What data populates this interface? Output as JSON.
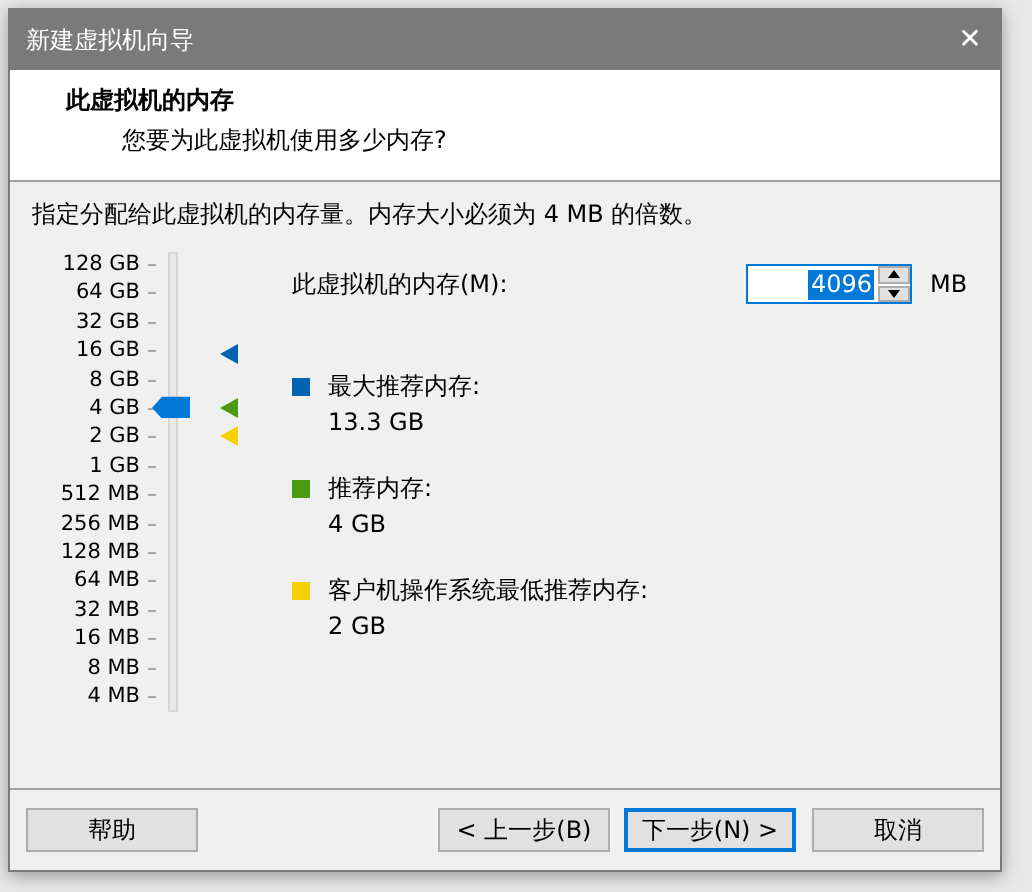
{
  "window": {
    "title": "新建虚拟机向导",
    "close": "✕"
  },
  "header": {
    "title": "此虚拟机的内存",
    "subtitle": "您要为此虚拟机使用多少内存?"
  },
  "intro": "指定分配给此虚拟机的内存量。内存大小必须为 4 MB 的倍数。",
  "slider": {
    "ticks": [
      "128 GB",
      "64 GB",
      "32 GB",
      "16 GB",
      "8 GB",
      "4 GB",
      "2 GB",
      "1 GB",
      "512 MB",
      "256 MB",
      "128 MB",
      "64 MB",
      "32 MB",
      "16 MB",
      "8 MB",
      "4 MB"
    ],
    "level": 0.667,
    "markers": [
      {
        "color": "#0063b1",
        "level": 0.792
      },
      {
        "color": "#4c9a10",
        "level": 0.667
      },
      {
        "color": "#f5d000",
        "level": 0.6
      }
    ]
  },
  "memory_field": {
    "label": "此虚拟机的内存(M):",
    "value": "4096",
    "unit": "MB"
  },
  "legend": [
    {
      "color": "#0063b1",
      "label": "最大推荐内存:",
      "value": "13.3 GB"
    },
    {
      "color": "#4c9a10",
      "label": "推荐内存:",
      "value": "4 GB"
    },
    {
      "color": "#f5d000",
      "label": "客户机操作系统最低推荐内存:",
      "value": "2 GB"
    }
  ],
  "buttons": [
    {
      "label": "帮助",
      "kind": "help",
      "default": false
    },
    {
      "label": "< 上一步(B)",
      "kind": "nav",
      "default": false
    },
    {
      "label": "下一步(N) >",
      "kind": "nav",
      "default": true
    },
    {
      "label": "取消",
      "kind": "cancel",
      "default": false
    }
  ]
}
